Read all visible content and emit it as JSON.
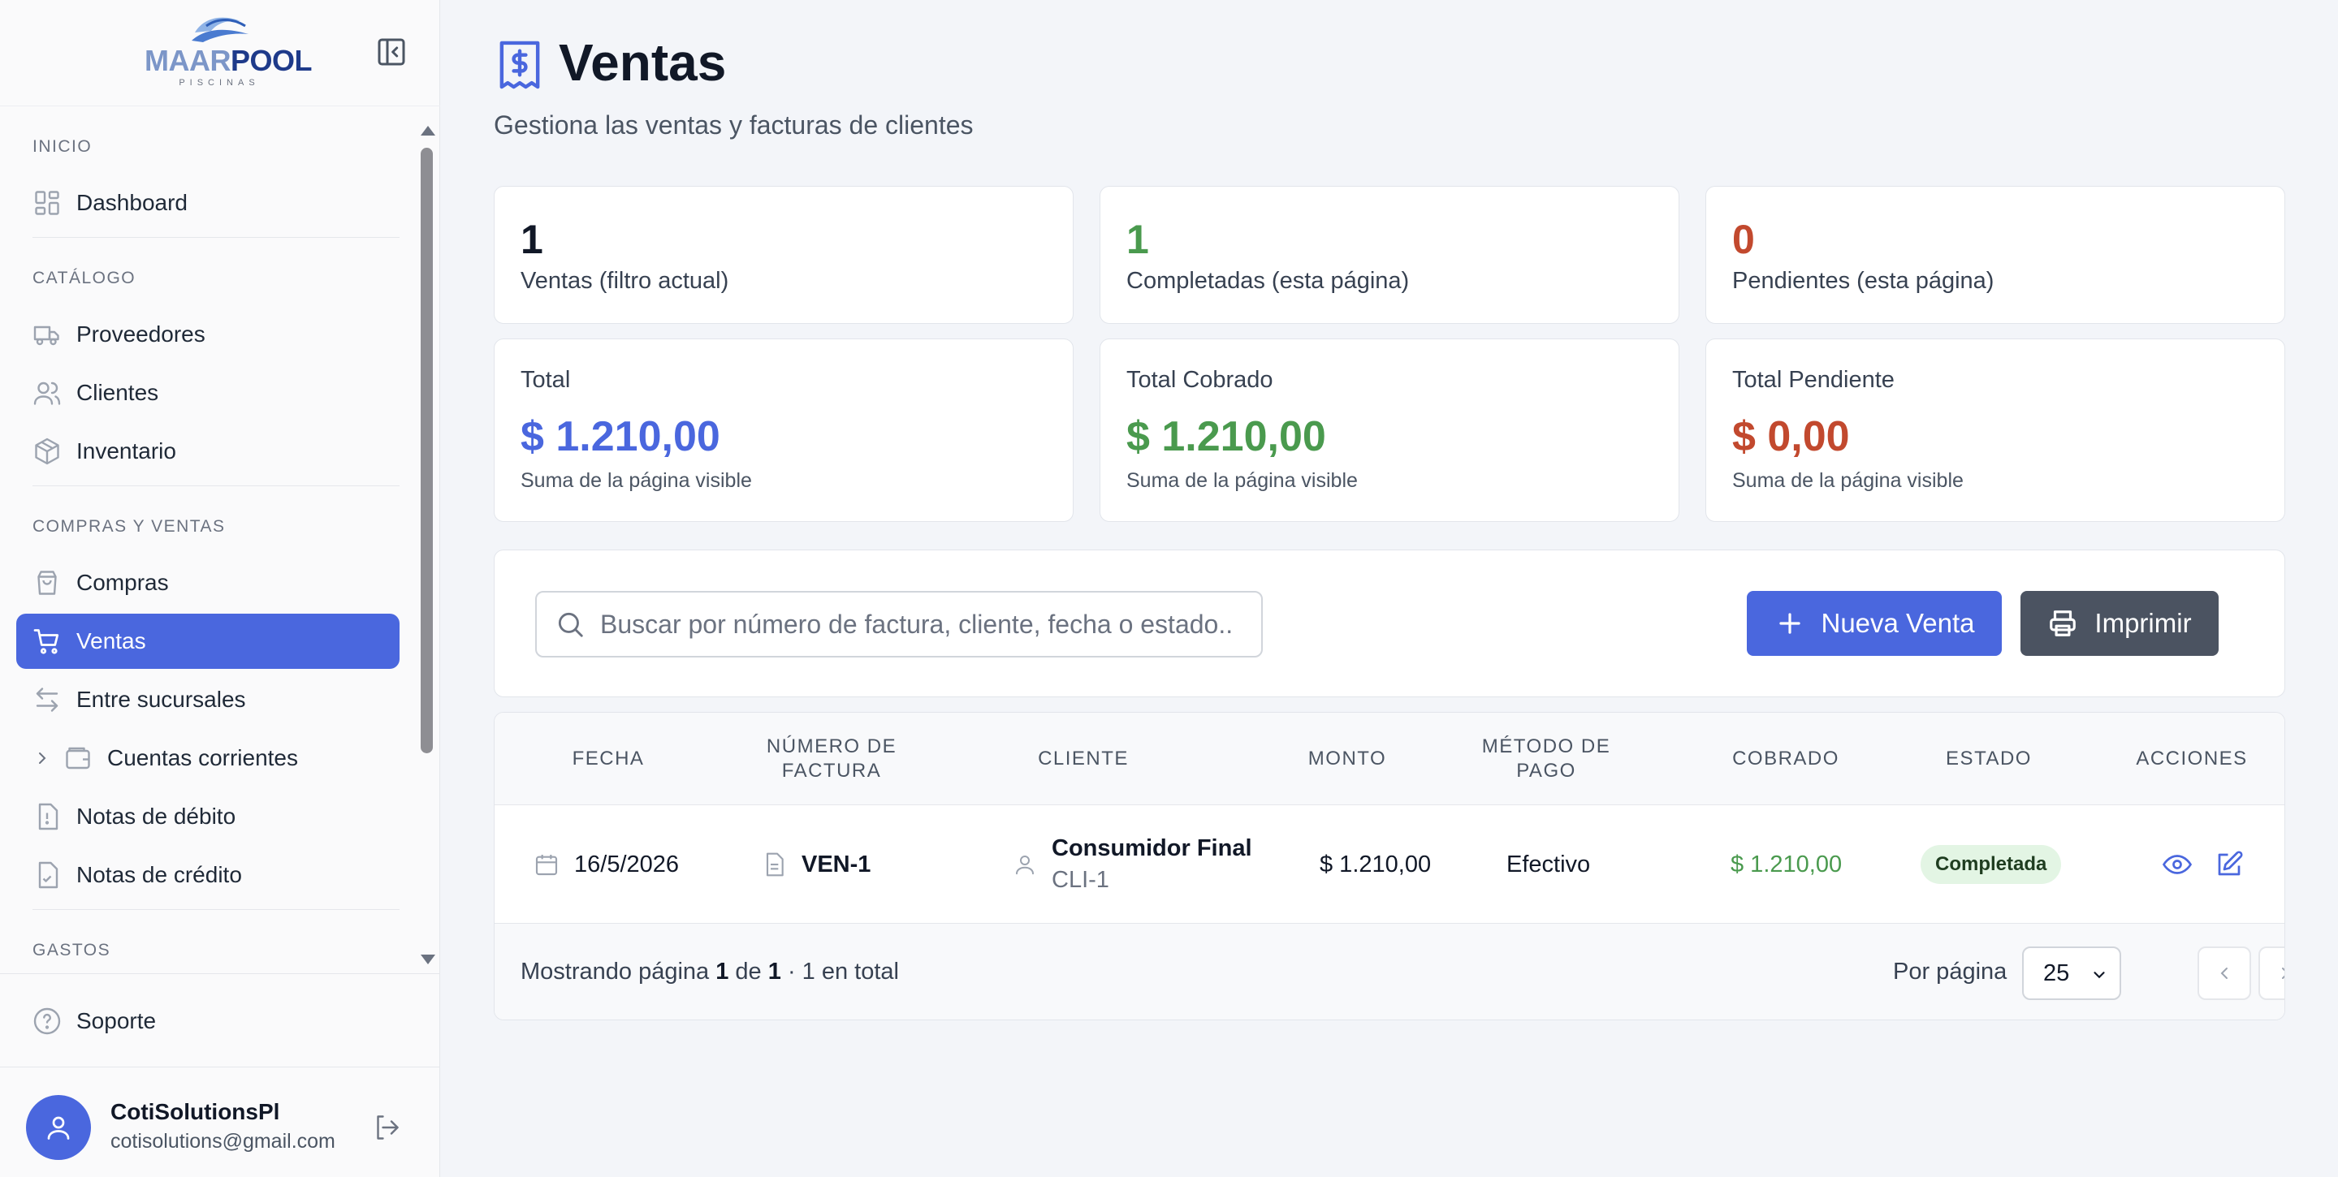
{
  "brand": {
    "logo_part1": "MAAR",
    "logo_part2": "POOL",
    "logo_sub": "PISCINAS"
  },
  "sidebar": {
    "sections": [
      {
        "title": "INICIO",
        "items": [
          {
            "label": "Dashboard",
            "icon": "dashboard-icon"
          }
        ]
      },
      {
        "title": "CATÁLOGO",
        "items": [
          {
            "label": "Proveedores",
            "icon": "truck-icon"
          },
          {
            "label": "Clientes",
            "icon": "users-icon"
          },
          {
            "label": "Inventario",
            "icon": "box-icon"
          }
        ]
      },
      {
        "title": "COMPRAS Y VENTAS",
        "items": [
          {
            "label": "Compras",
            "icon": "shopping-bag-icon"
          },
          {
            "label": "Ventas",
            "icon": "cart-icon",
            "active": true
          },
          {
            "label": "Entre sucursales",
            "icon": "transfer-icon"
          },
          {
            "label": "Cuentas corrientes",
            "icon": "wallet-icon",
            "expandable": true
          },
          {
            "label": "Notas de débito",
            "icon": "file-alert-icon"
          },
          {
            "label": "Notas de crédito",
            "icon": "file-check-icon"
          }
        ]
      },
      {
        "title": "GASTOS",
        "items": []
      }
    ],
    "support_label": "Soporte",
    "user": {
      "name": "CotiSolutionsPl",
      "email": "cotisolutions@gmail.com"
    }
  },
  "page": {
    "title": "Ventas",
    "subtitle": "Gestiona las ventas y facturas de clientes"
  },
  "stats": [
    {
      "value": "1",
      "label": "Ventas (filtro actual)"
    },
    {
      "value": "1",
      "label": "Completadas (esta página)"
    },
    {
      "value": "0",
      "label": "Pendientes (esta página)"
    }
  ],
  "totals": [
    {
      "label": "Total",
      "value": "$ 1.210,00",
      "note": "Suma de la página visible"
    },
    {
      "label": "Total Cobrado",
      "value": "$ 1.210,00",
      "note": "Suma de la página visible"
    },
    {
      "label": "Total Pendiente",
      "value": "$ 0,00",
      "note": "Suma de la página visible"
    }
  ],
  "toolbar": {
    "search_placeholder": "Buscar por número de factura, cliente, fecha o estado...",
    "search_value": "",
    "new_label": "Nueva Venta",
    "print_label": "Imprimir"
  },
  "table": {
    "headers": {
      "fecha": "FECHA",
      "numero_1": "NÚMERO DE",
      "numero_2": "FACTURA",
      "cliente": "CLIENTE",
      "monto": "MONTO",
      "metodo_1": "MÉTODO DE",
      "metodo_2": "PAGO",
      "cobrado": "COBRADO",
      "estado": "ESTADO",
      "acciones": "ACCIONES"
    },
    "rows": [
      {
        "fecha": "16/5/2026",
        "numero": "VEN-1",
        "cliente": "Consumidor Final",
        "cliente_code": "CLI-1",
        "monto": "$ 1.210,00",
        "metodo": "Efectivo",
        "cobrado": "$ 1.210,00",
        "estado": "Completada"
      }
    ]
  },
  "pagination": {
    "prefix": "Mostrando página",
    "page": "1",
    "of": "de",
    "pages": "1",
    "total_text": "· 1 en total",
    "per_page_label": "Por página",
    "per_page_value": "25"
  },
  "colors": {
    "accent": "#4a67de",
    "green": "#4a9a4e",
    "orange": "#c2492e",
    "print_btn": "#4b5361"
  }
}
